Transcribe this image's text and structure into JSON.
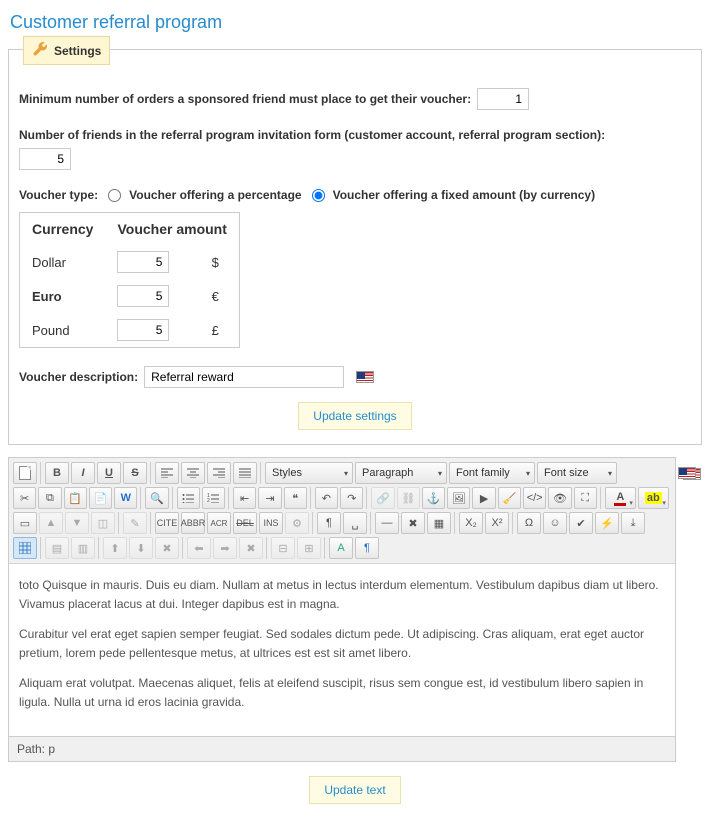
{
  "page": {
    "title": "Customer referral program"
  },
  "settings": {
    "legend": "Settings",
    "min_orders_label": "Minimum number of orders a sponsored friend must place to get their voucher:",
    "min_orders_value": "1",
    "num_friends_label": "Number of friends in the referral program invitation form (customer account, referral program section):",
    "num_friends_value": "5",
    "voucher_type_label": "Voucher type:",
    "voucher_percent_label": "Voucher offering a percentage",
    "voucher_fixed_label": "Voucher offering a fixed amount (by currency)",
    "currency_header": "Currency",
    "amount_header": "Voucher amount",
    "currencies": [
      {
        "name": "Dollar",
        "value": "5",
        "symbol": "$"
      },
      {
        "name": "Euro",
        "value": "5",
        "symbol": "€",
        "bold": true
      },
      {
        "name": "Pound",
        "value": "5",
        "symbol": "£"
      }
    ],
    "voucher_desc_label": "Voucher description:",
    "voucher_desc_value": "Referral reward",
    "update_settings_btn": "Update settings"
  },
  "editor": {
    "selects": {
      "styles": "Styles",
      "paragraph": "Paragraph",
      "fontfamily": "Font family",
      "fontsize": "Font size"
    },
    "content_p1": "toto Quisque in mauris. Duis eu diam. Nullam at metus in lectus interdum elementum. Vestibulum dapibus diam ut libero. Vivamus placerat lacus at dui. Integer dapibus est in magna.",
    "content_p2": "Curabitur vel erat eget sapien semper feugiat. Sed sodales dictum pede. Ut adipiscing. Cras aliquam, erat eget auctor pretium, lorem pede pellentesque metus, at ultrices est est sit amet libero.",
    "content_p3": "Aliquam erat volutpat. Maecenas aliquet, felis at eleifend suscipit, risus sem congue est, id vestibulum libero sapien in ligula. Nulla ut urna id eros lacinia gravida.",
    "path_label": "Path:",
    "path_value": "p",
    "update_text_btn": "Update text"
  }
}
